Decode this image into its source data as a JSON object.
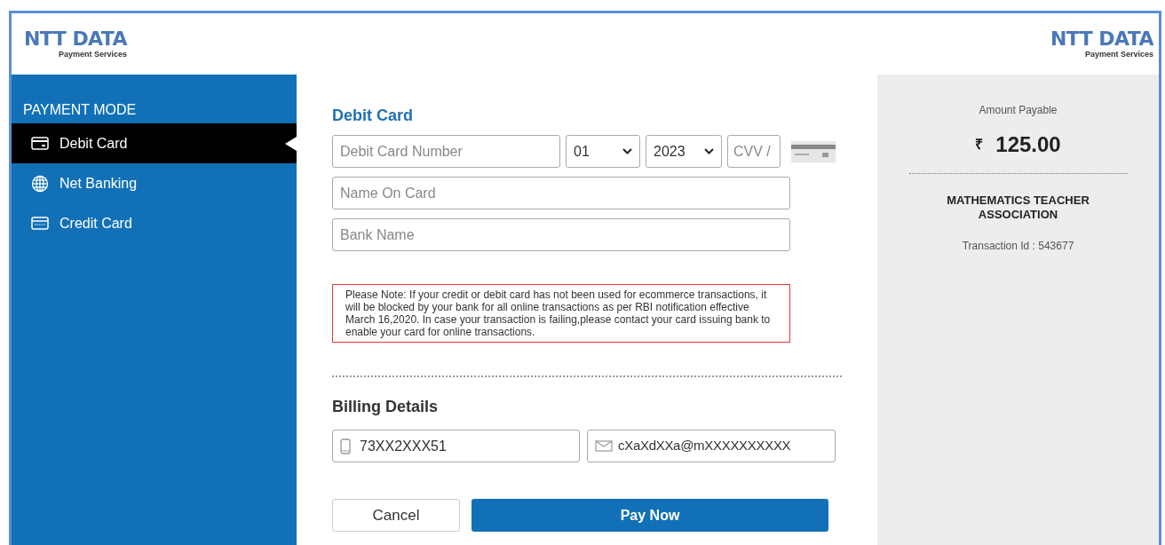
{
  "header": {
    "logo_left": {
      "name": "NTT DATA",
      "tagline": "Payment Services"
    },
    "logo_right": {
      "name": "NTT DATA",
      "tagline": "Payment Services"
    }
  },
  "sidebar": {
    "title": "PAYMENT MODE",
    "items": [
      {
        "label": "Debit Card",
        "kind": "debit",
        "selected": true
      },
      {
        "label": "Net Banking",
        "kind": "netbanking",
        "selected": false
      },
      {
        "label": "Credit Card",
        "kind": "credit",
        "selected": false
      }
    ]
  },
  "form": {
    "title": "Debit Card",
    "card_number": {
      "placeholder": "Debit Card Number"
    },
    "expiry_month": {
      "value": "01"
    },
    "expiry_year": {
      "value": "2023"
    },
    "cvv": {
      "placeholder": "CVV /"
    },
    "name_on_card": {
      "placeholder": "Name On Card"
    },
    "bank_name": {
      "placeholder": "Bank Name"
    },
    "note": "Please Note: If your credit or debit card has not been used for ecommerce transactions, it will be blocked by your bank for all online transactions as per RBI notification effective March 16,2020. In case your transaction is failing,please contact your card issuing bank to enable your card for online transactions.",
    "billing_title": "Billing Details",
    "phone": {
      "value": "73XX2XXX51"
    },
    "email": {
      "value": "cXaXdXXa@mXXXXXXXXXX"
    },
    "buttons": {
      "cancel": "Cancel",
      "pay": "Pay Now"
    }
  },
  "summary": {
    "label": "Amount Payable",
    "currency": "₹",
    "amount": "125.00",
    "merchant": "MATHEMATICS TEACHER ASSOCIATION",
    "transaction": "Transaction Id : 543677"
  }
}
